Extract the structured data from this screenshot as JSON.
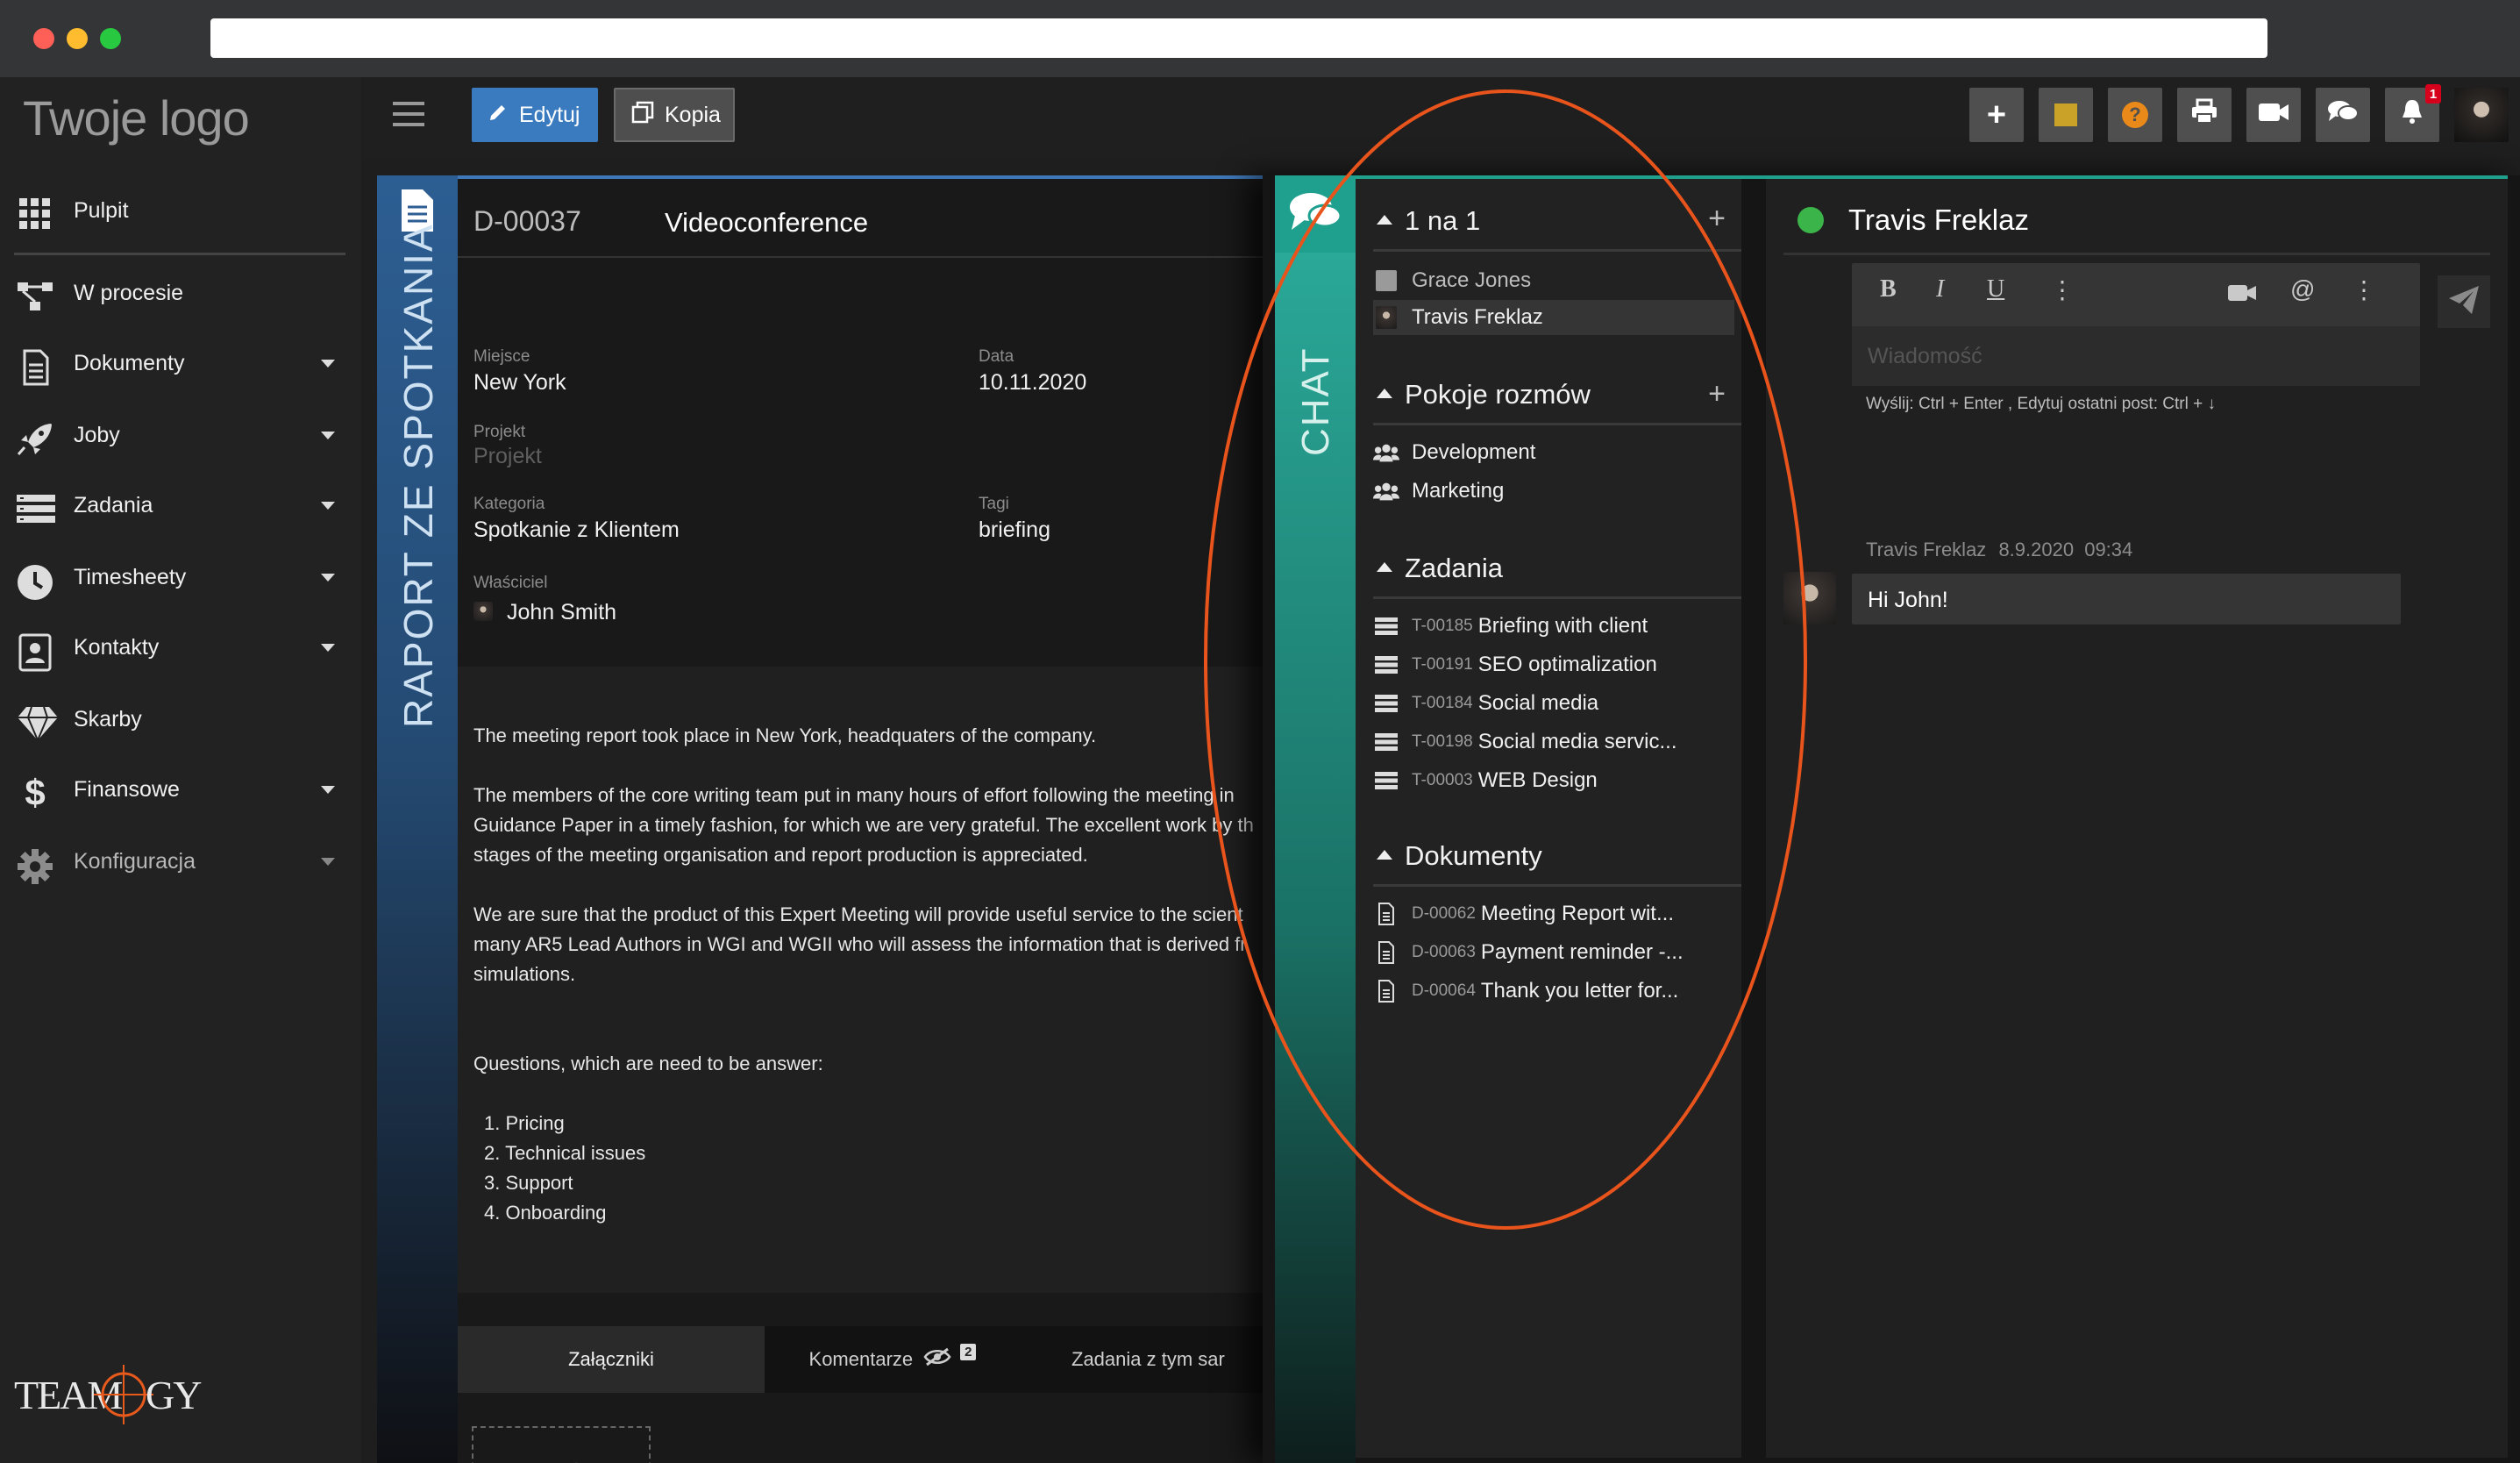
{
  "window": {
    "controls": [
      "close",
      "minimize",
      "maximize"
    ]
  },
  "sidebar": {
    "logo": "Twoje logo",
    "items": [
      {
        "label": "Pulpit",
        "icon": "grid-icon",
        "caret": false
      },
      {
        "label": "W procesie",
        "icon": "workflow-icon",
        "caret": false
      },
      {
        "label": "Dokumenty",
        "icon": "document-icon",
        "caret": true
      },
      {
        "label": "Joby",
        "icon": "rocket-icon",
        "caret": true
      },
      {
        "label": "Zadania",
        "icon": "tasks-icon",
        "caret": true
      },
      {
        "label": "Timesheety",
        "icon": "clock-icon",
        "caret": true
      },
      {
        "label": "Kontakty",
        "icon": "contact-card-icon",
        "caret": true
      },
      {
        "label": "Skarby",
        "icon": "diamond-icon",
        "caret": false
      },
      {
        "label": "Finansowe",
        "icon": "dollar-icon",
        "caret": true
      },
      {
        "label": "Konfiguracja",
        "icon": "gear-icon",
        "caret": true
      }
    ],
    "brand": "TEAMOLOGY"
  },
  "toolbar": {
    "edit_label": "Edytuj",
    "copy_label": "Kopia",
    "notification_count": "1",
    "colors": {
      "edit": "#3a7bbf",
      "copy": "#4e4e4e",
      "help": "#e8891a",
      "note": "#c9a227",
      "badge": "#d6001c"
    }
  },
  "document": {
    "vertical_title": "RAPORT ZE SPOTKANIA",
    "id": "D-00037",
    "title": "Videoconference",
    "fields": {
      "place_label": "Miejsce",
      "place_value": "New York",
      "date_label": "Data",
      "date_value": "10.11.2020",
      "project_label": "Projekt",
      "project_value": "Projekt",
      "category_label": "Kategoria",
      "category_value": "Spotkanie z Klientem",
      "tags_label": "Tagi",
      "tags_value": "briefing",
      "owner_label": "Właściciel",
      "owner_value": "John Smith"
    },
    "body": {
      "p1": "The meeting report took place in New York, headquaters of the company.",
      "p2_l1": "The members of the core writing team put in many hours of effort following the meeting in",
      "p2_l2": "Guidance Paper in a timely fashion, for which we are very grateful. The excellent work by th",
      "p2_l3": "stages of the meeting organisation and report production is appreciated.",
      "p3_l1": "We are sure that the product of this Expert Meeting will provide useful service to the scient",
      "p3_l2": "many AR5 Lead Authors in WGI and WGII who will assess the information that is derived fr",
      "p3_l3": "simulations.",
      "questions": "Questions, which are need to be answer:",
      "list": [
        "1. Pricing",
        "2. Technical issues",
        "3. Support",
        "4. Onboarding"
      ]
    },
    "tabs": {
      "attachments": "Załączniki",
      "comments": "Komentarze",
      "comments_count": "2",
      "tasks": "Zadania z tym sar"
    }
  },
  "chat": {
    "vertical_title": "CHAT",
    "one_on_one": {
      "title": "1 na 1",
      "people": [
        {
          "name": "Grace Jones",
          "selected": false
        },
        {
          "name": "Travis Freklaz",
          "selected": true
        }
      ]
    },
    "rooms": {
      "title": "Pokoje rozmów",
      "items": [
        "Development",
        "Marketing"
      ]
    },
    "tasks": {
      "title": "Zadania",
      "items": [
        {
          "code": "T-00185",
          "name": "Briefing with client"
        },
        {
          "code": "T-00191",
          "name": "SEO optimalization"
        },
        {
          "code": "T-00184",
          "name": "Social media"
        },
        {
          "code": "T-00198",
          "name": "Social media servic..."
        },
        {
          "code": "T-00003",
          "name": "WEB Design"
        }
      ]
    },
    "documents": {
      "title": "Dokumenty",
      "items": [
        {
          "code": "D-00062",
          "name": "Meeting Report wit..."
        },
        {
          "code": "D-00063",
          "name": "Payment reminder -..."
        },
        {
          "code": "D-00064",
          "name": "Thank you letter for..."
        }
      ]
    },
    "conversation": {
      "contact_name": "Travis Freklaz",
      "status_color": "#3bb54a",
      "message_placeholder": "Wiadomość",
      "hint": "Wyślij: Ctrl + Enter , Edytuj ostatni post: Ctrl + ↓",
      "messages": [
        {
          "author": "Travis Freklaz",
          "date": "8.9.2020",
          "time": "09:34",
          "text": "Hi John!"
        }
      ]
    }
  }
}
